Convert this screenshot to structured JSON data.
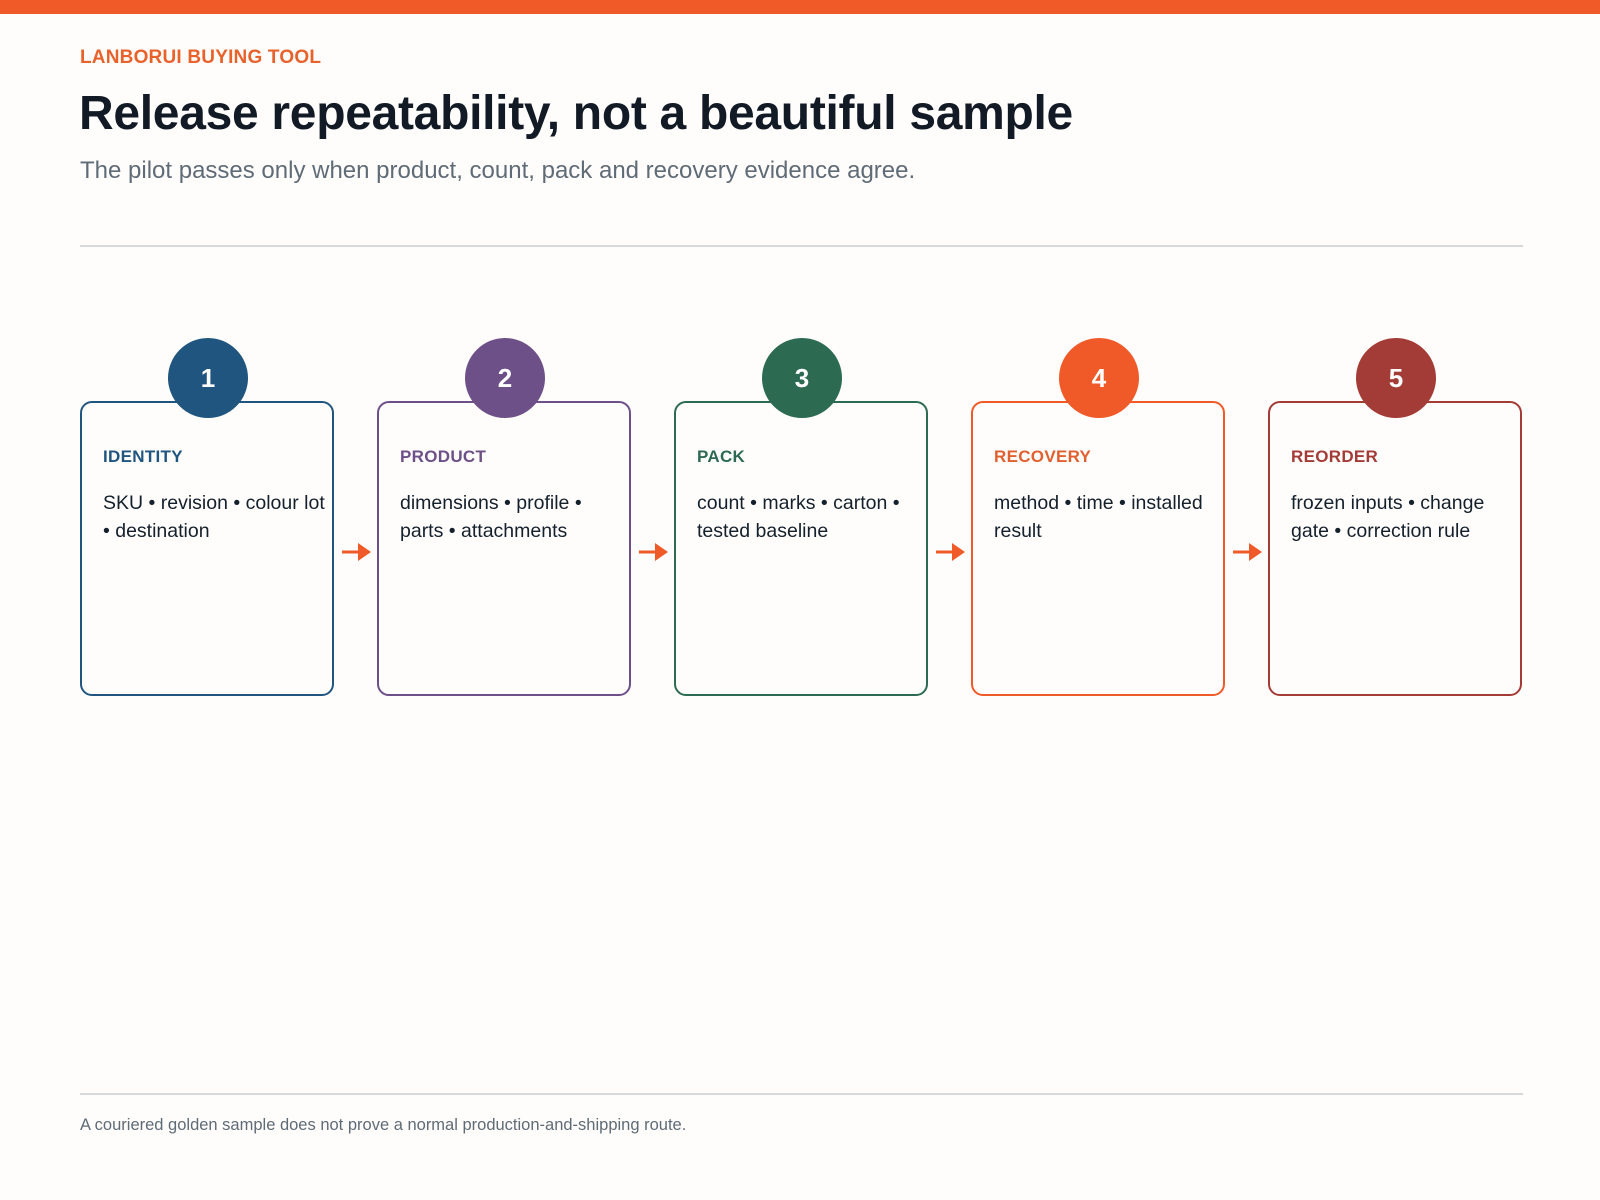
{
  "header": {
    "eyebrow": "LANBORUI BUYING TOOL",
    "title": "Release repeatability, not a beautiful sample",
    "subtitle": "The pilot passes only when product, count, pack and recovery evidence agree."
  },
  "steps": [
    {
      "number": "1",
      "label": "IDENTITY",
      "text": "SKU • revision • colour lot • destination",
      "color": "#1f557f"
    },
    {
      "number": "2",
      "label": "PRODUCT",
      "text": "dimensions • profile • parts • attachments",
      "color": "#6e5089"
    },
    {
      "number": "3",
      "label": "PACK",
      "text": "count • marks • carton • tested baseline",
      "color": "#2c6b51"
    },
    {
      "number": "4",
      "label": "RECOVERY",
      "text": "method • time • installed result",
      "color": "#f05a28",
      "label_color": "#e06030"
    },
    {
      "number": "5",
      "label": "REORDER",
      "text": "frozen inputs • change gate • correction rule",
      "color": "#a33b36"
    }
  ],
  "arrow_color": "#f05a28",
  "footer": {
    "note": "A couriered golden sample does not prove a normal production-and-shipping route."
  }
}
